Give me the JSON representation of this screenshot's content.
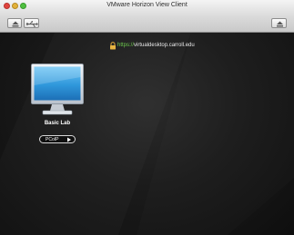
{
  "window": {
    "title": "VMware Horizon View Client"
  },
  "toolbar": {
    "buttons": [
      {
        "icon": "eject-icon"
      },
      {
        "icon": "usb-icon"
      },
      {
        "icon": "eject-icon"
      }
    ]
  },
  "server": {
    "protocol": "https://",
    "host": "virtualdesktop.carroll.edu",
    "icon": "lock-icon"
  },
  "desktops": [
    {
      "name": "Basic Lab",
      "icon": "monitor-icon",
      "protocol": "PCoIP"
    }
  ],
  "colors": {
    "accent_blue": "#3aa0e0",
    "protocol_green": "#6ecb4e"
  }
}
